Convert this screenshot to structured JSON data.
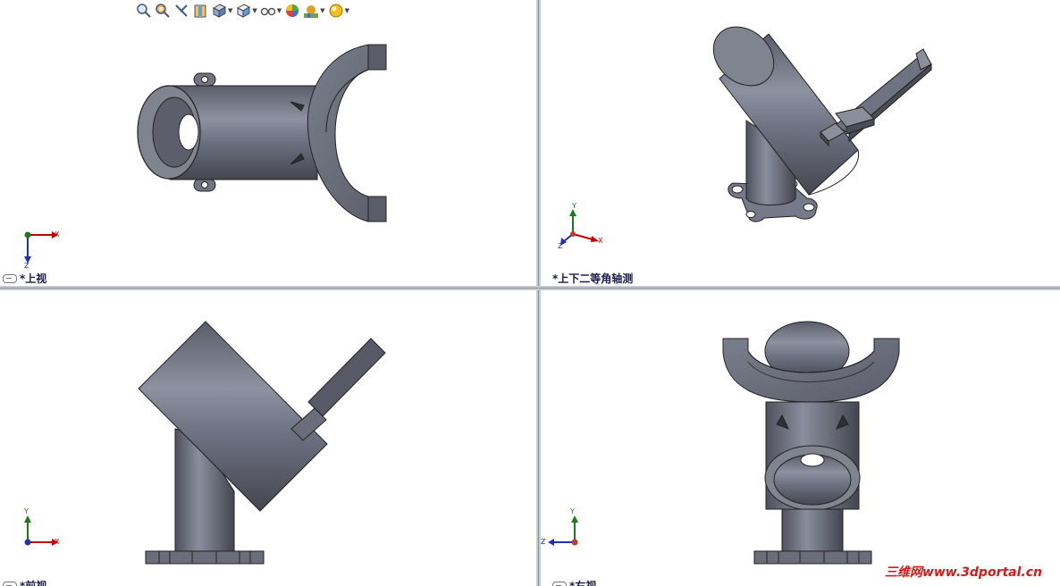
{
  "views": {
    "top": {
      "label": "*上视"
    },
    "iso": {
      "label": "*上下二等角轴测"
    },
    "front": {
      "label": "*前视"
    },
    "right": {
      "label": "*右视"
    }
  },
  "triad_labels": {
    "x": "X",
    "y": "Y",
    "z": "Z"
  },
  "toolbar": [
    "zoom-to-fit-icon",
    "zoom-to-area-icon",
    "previous-view-icon",
    "section-view-icon",
    "view-orientation-icon",
    "display-style-icon",
    "hide-show-items-icon",
    "edit-appearance-icon",
    "apply-scene-icon",
    "view-settings-icon"
  ],
  "watermark": {
    "text": "三维网www.3dportal.cn"
  },
  "colors": {
    "part": "#6b6e7a",
    "part_light": "#8f93a0",
    "part_dark": "#474a55",
    "background": "#ffffff",
    "divider": "#8a8f98",
    "label": "#1b1b4b",
    "watermark": "#d21a1a"
  }
}
